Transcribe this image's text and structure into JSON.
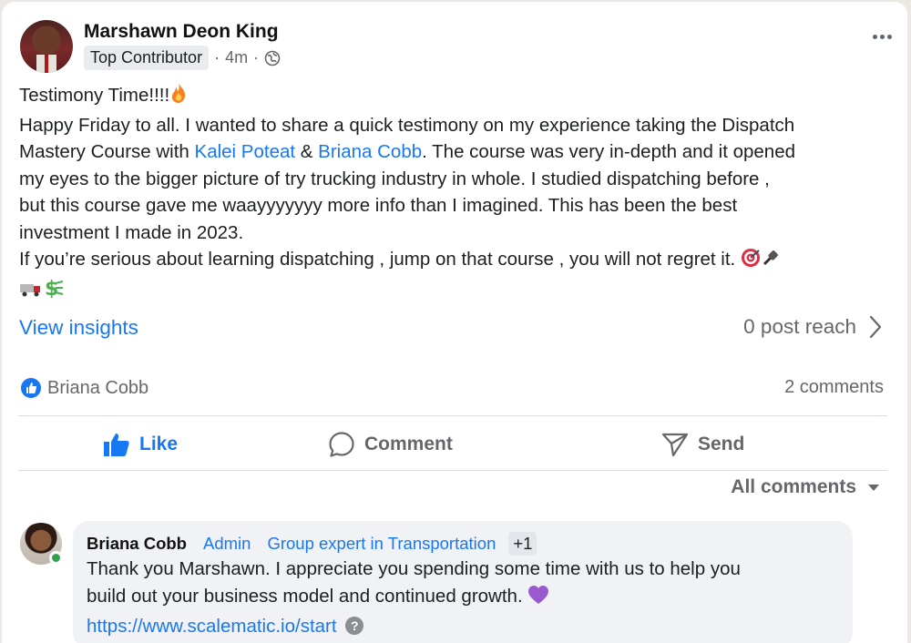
{
  "post": {
    "author": "Marshawn Deon King",
    "badge": "Top Contributor",
    "time": "4m",
    "separator": "·",
    "lines": {
      "l1": "Testimony Time!!!!",
      "l2": "Happy Friday to all. I wanted to share a quick testimony on my experience taking the Dispatch",
      "l3_pre": "Mastery Course with ",
      "mention1": "Kalei Poteat",
      "l3_amp": " & ",
      "mention2": "Briana Cobb",
      "l3_post": ". The course was very in-depth and it opened",
      "l4": "my eyes to the bigger picture of try trucking industry in whole. I studied dispatching before ,",
      "l5": "but this course gave me waayyyyyyy more info than I imagined. This has been the best",
      "l6": "investment I made in 2023.",
      "l7": "If you’re serious about learning dispatching , jump on that course , you will not regret it."
    }
  },
  "insights": {
    "link_label": "View insights",
    "reach_label": "0 post reach"
  },
  "reactions": {
    "reactor": "Briana Cobb",
    "comments_count": "2 comments"
  },
  "actions": {
    "like": "Like",
    "comment": "Comment",
    "send": "Send"
  },
  "comments_filter": "All comments",
  "comment": {
    "author": "Briana Cobb",
    "role1": "Admin",
    "role2": "Group expert in Transportation",
    "more_badges": "+1",
    "line1": "Thank you Marshawn. I appreciate you spending some time with us to help you",
    "line2": "build out your business model and continued growth.",
    "link": "https://www.scalematic.io/start",
    "help": "?"
  },
  "colors": {
    "accent": "#1877f2",
    "secondary_text": "#65676b",
    "online": "#31a24c"
  },
  "icons": [
    "globe-icon",
    "more-icon",
    "fire-emoji",
    "target-emoji",
    "truck-emoji",
    "money-emoji",
    "chevron-right-icon",
    "like-reaction-icon",
    "thumbs-up-icon",
    "comment-icon",
    "send-icon",
    "caret-down-icon",
    "purple-heart-emoji",
    "help-icon"
  ]
}
